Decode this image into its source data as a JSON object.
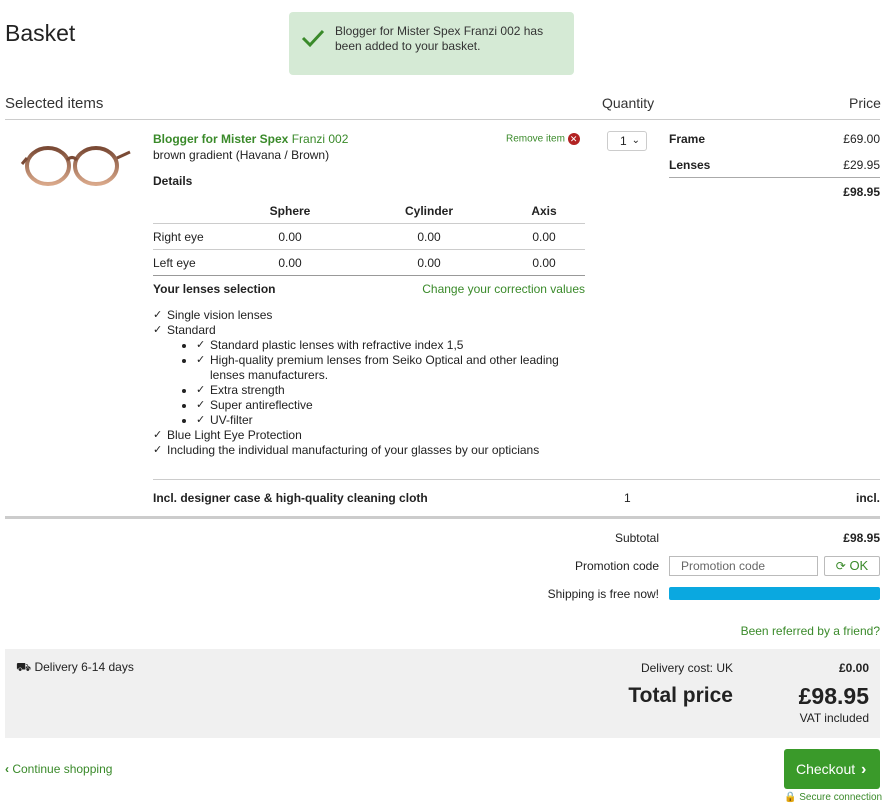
{
  "page_title": "Basket",
  "toast": {
    "message": "Blogger for Mister Spex Franzi 002 has been added to your basket."
  },
  "headers": {
    "selected_items": "Selected items",
    "quantity": "Quantity",
    "price": "Price"
  },
  "product": {
    "brand": "Blogger for Mister Spex",
    "model": "Franzi 002",
    "color": "brown gradient (Havana / Brown)",
    "remove_label": "Remove item",
    "quantity": "1",
    "details_label": "Details",
    "prescription": {
      "columns": [
        "Sphere",
        "Cylinder",
        "Axis"
      ],
      "rows": [
        {
          "label": "Right eye",
          "sphere": "0.00",
          "cylinder": "0.00",
          "axis": "0.00"
        },
        {
          "label": "Left eye",
          "sphere": "0.00",
          "cylinder": "0.00",
          "axis": "0.00"
        }
      ]
    },
    "lenses_selection_label": "Your lenses selection",
    "change_correction_link": "Change your correction values",
    "lens_features": {
      "single_vision": "Single vision lenses",
      "standard": "Standard",
      "standard_items": [
        "Standard plastic lenses with refractive index 1,5",
        "High-quality premium lenses from Seiko Optical and other leading lenses manufacturers.",
        "Extra strength",
        "Super antireflective",
        "UV-filter"
      ],
      "blue_light": "Blue Light Eye Protection",
      "manufacturing": "Including the individual manufacturing of your glasses by our opticians"
    },
    "prices": {
      "frame_label": "Frame",
      "frame_value": "£69.00",
      "lenses_label": "Lenses",
      "lenses_value": "£29.95",
      "item_total": "£98.95"
    },
    "extras": {
      "label": "Incl. designer case & high-quality cleaning cloth",
      "quantity": "1",
      "price": "incl."
    }
  },
  "totals": {
    "subtotal_label": "Subtotal",
    "subtotal_value": "£98.95",
    "promo_label": "Promotion code",
    "promo_placeholder": "Promotion code",
    "promo_button": "OK",
    "shipping_label": "Shipping is free now!",
    "shipping_progress": 1.0,
    "referred_link": "Been referred by a friend?"
  },
  "summary": {
    "delivery_label": "Delivery 6-14 days",
    "delivery_cost_label": "Delivery cost: UK",
    "delivery_cost_value": "£0.00",
    "total_label": "Total price",
    "total_value": "£98.95",
    "vat_note": "VAT included"
  },
  "footer": {
    "continue_label": "Continue shopping",
    "checkout_label": "Checkout",
    "secure_label": "Secure connection"
  },
  "colors": {
    "accent_green": "#3a8a2a",
    "checkout_bg": "#3a9a2a",
    "shipping_bar": "#0aa8e0",
    "toast_bg": "#d5ead5",
    "remove_red": "#b22222"
  }
}
